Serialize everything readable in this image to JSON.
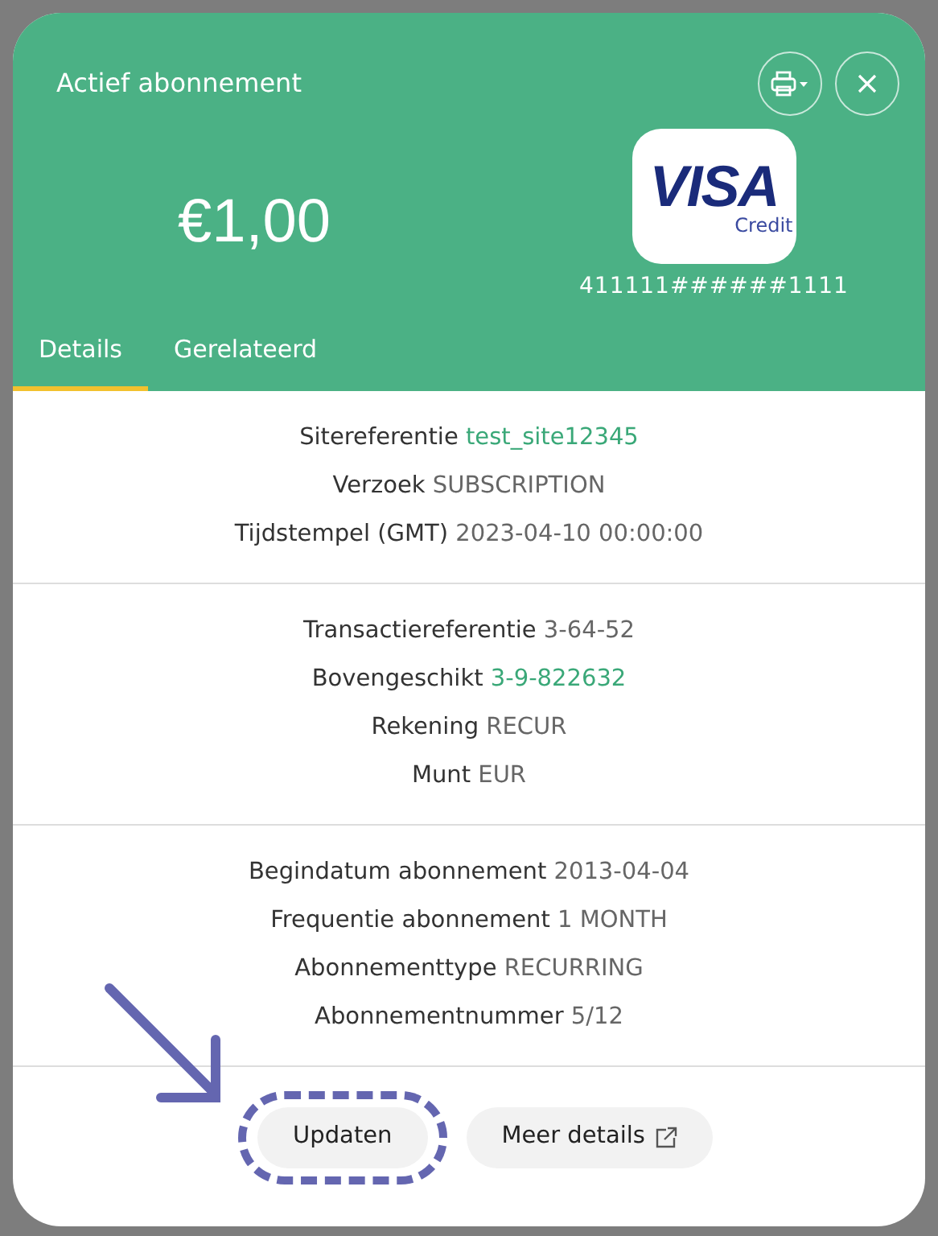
{
  "dialog": {
    "title": "Actief abonnement"
  },
  "amount": "€1,00",
  "card": {
    "brand": "VISA",
    "subtitle": "Credit",
    "number": "411111######1111"
  },
  "tabs": [
    {
      "label": "Details",
      "selected": true
    },
    {
      "label": "Gerelateerd",
      "selected": false
    }
  ],
  "sections": [
    {
      "rows": [
        {
          "label": "Sitereferentie",
          "value": "test_site12345",
          "kind": "link"
        },
        {
          "label": "Verzoek",
          "value": "SUBSCRIPTION",
          "kind": "text"
        },
        {
          "label": "Tijdstempel (GMT)",
          "value": "2023-04-10 00:00:00",
          "kind": "text"
        }
      ]
    },
    {
      "rows": [
        {
          "label": "Transactiereferentie",
          "value": "3-64-52",
          "kind": "text"
        },
        {
          "label": "Bovengeschikt",
          "value": "3-9-822632",
          "kind": "link"
        },
        {
          "label": "Rekening",
          "value": "RECUR",
          "kind": "text"
        },
        {
          "label": "Munt",
          "value": "EUR",
          "kind": "text"
        }
      ]
    },
    {
      "rows": [
        {
          "label": "Begindatum abonnement",
          "value": "2013-04-04",
          "kind": "text"
        },
        {
          "label": "Frequentie abonnement",
          "value": "1 MONTH",
          "kind": "text"
        },
        {
          "label": "Abonnementtype",
          "value": "RECURRING",
          "kind": "text"
        },
        {
          "label": "Abonnementnummer",
          "value": "5/12",
          "kind": "text"
        }
      ]
    }
  ],
  "buttons": [
    {
      "label": "Updaten",
      "highlighted": true,
      "external": false
    },
    {
      "label": "Meer details",
      "highlighted": false,
      "external": true
    }
  ]
}
